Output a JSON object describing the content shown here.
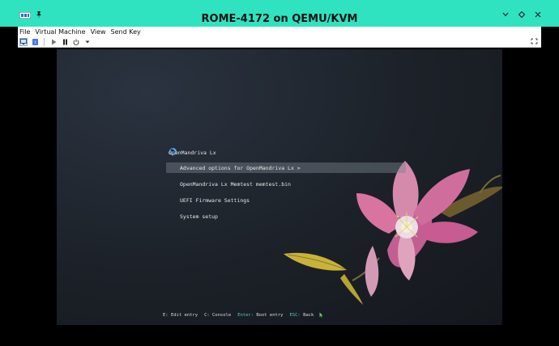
{
  "window": {
    "title": "ROME-4172 on QEMU/KVM",
    "controls": [
      "minimize-icon",
      "maximize-icon",
      "close-icon"
    ]
  },
  "menu": [
    "File",
    "Virtual Machine",
    "View",
    "Send Key"
  ],
  "toolbar": {
    "icons": [
      "console-icon",
      "details-icon",
      "run-icon",
      "pause-icon",
      "power-icon",
      "power-menu-icon",
      "fullscreen-icon"
    ]
  },
  "boot": {
    "entries": [
      "OpenMandriva Lx",
      "Advanced options for OpenMandriva Lx >",
      "OpenMandriva Lx Memtest memtest.bin",
      "UEFI Firmware Settings",
      "System setup"
    ],
    "selected_index": 1,
    "hints": [
      {
        "key": "E:",
        "action": "Edit entry"
      },
      {
        "key": "C:",
        "action": "Console"
      },
      {
        "key": "Enter:",
        "action": "Boot entry"
      },
      {
        "key": "ESC:",
        "action": "Back"
      }
    ]
  },
  "colors": {
    "titlebar": "#2fe3c0",
    "hint_enter": "#5bc7c9",
    "guest_bg": "#1c2128"
  }
}
